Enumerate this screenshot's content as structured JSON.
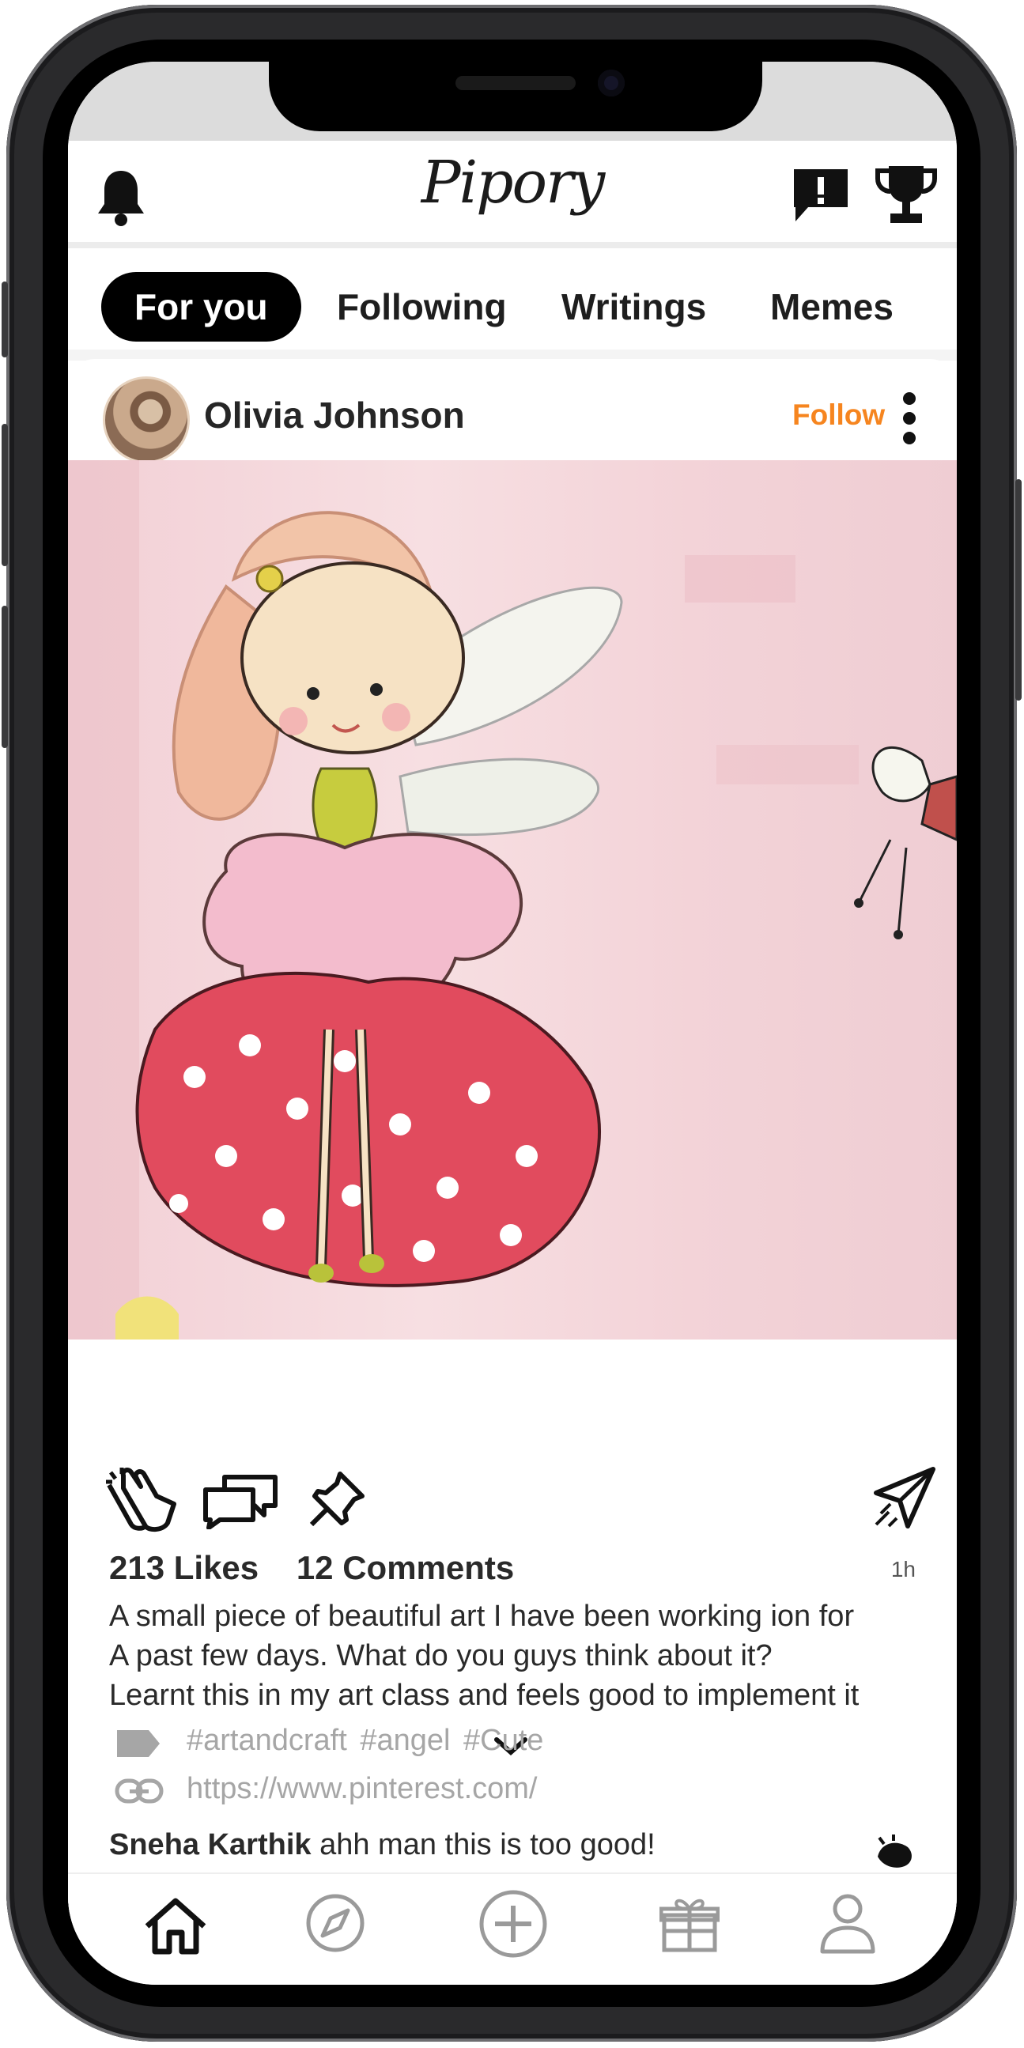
{
  "app": {
    "name": "Pipory"
  },
  "tabs": [
    {
      "label": "For you",
      "active": true
    },
    {
      "label": "Following",
      "active": false
    },
    {
      "label": "Writings",
      "active": false
    },
    {
      "label": "Memes",
      "active": false
    }
  ],
  "post": {
    "username": "Olivia Johnson",
    "follow_label": "Follow",
    "likes": "213 Likes",
    "comments": "12 Comments",
    "time": "1h",
    "caption_lines": [
      "A small piece of beautiful art I have been working ion for",
      "A past few days. What do you guys think about it?",
      "Learnt this in my art class and feels good to implement it"
    ],
    "tags": "#artandcraft  #angel  #Cute",
    "link": "https://www.pinterest.com/",
    "top_comment": {
      "author": "Sneha Karthik",
      "text": " ahh man this is too good!"
    }
  },
  "icons": {
    "header": [
      "bell-icon",
      "alert-message-icon",
      "trophy-icon"
    ],
    "actions": [
      "clap-icon",
      "comments-icon",
      "pin-icon",
      "send-icon"
    ],
    "nav": [
      "home-icon",
      "compass-icon",
      "plus-circle-icon",
      "gift-icon",
      "profile-icon"
    ]
  },
  "colors": {
    "follow": "#f6851f",
    "active_tab_bg": "#000000",
    "muted": "#a6a6a6"
  }
}
